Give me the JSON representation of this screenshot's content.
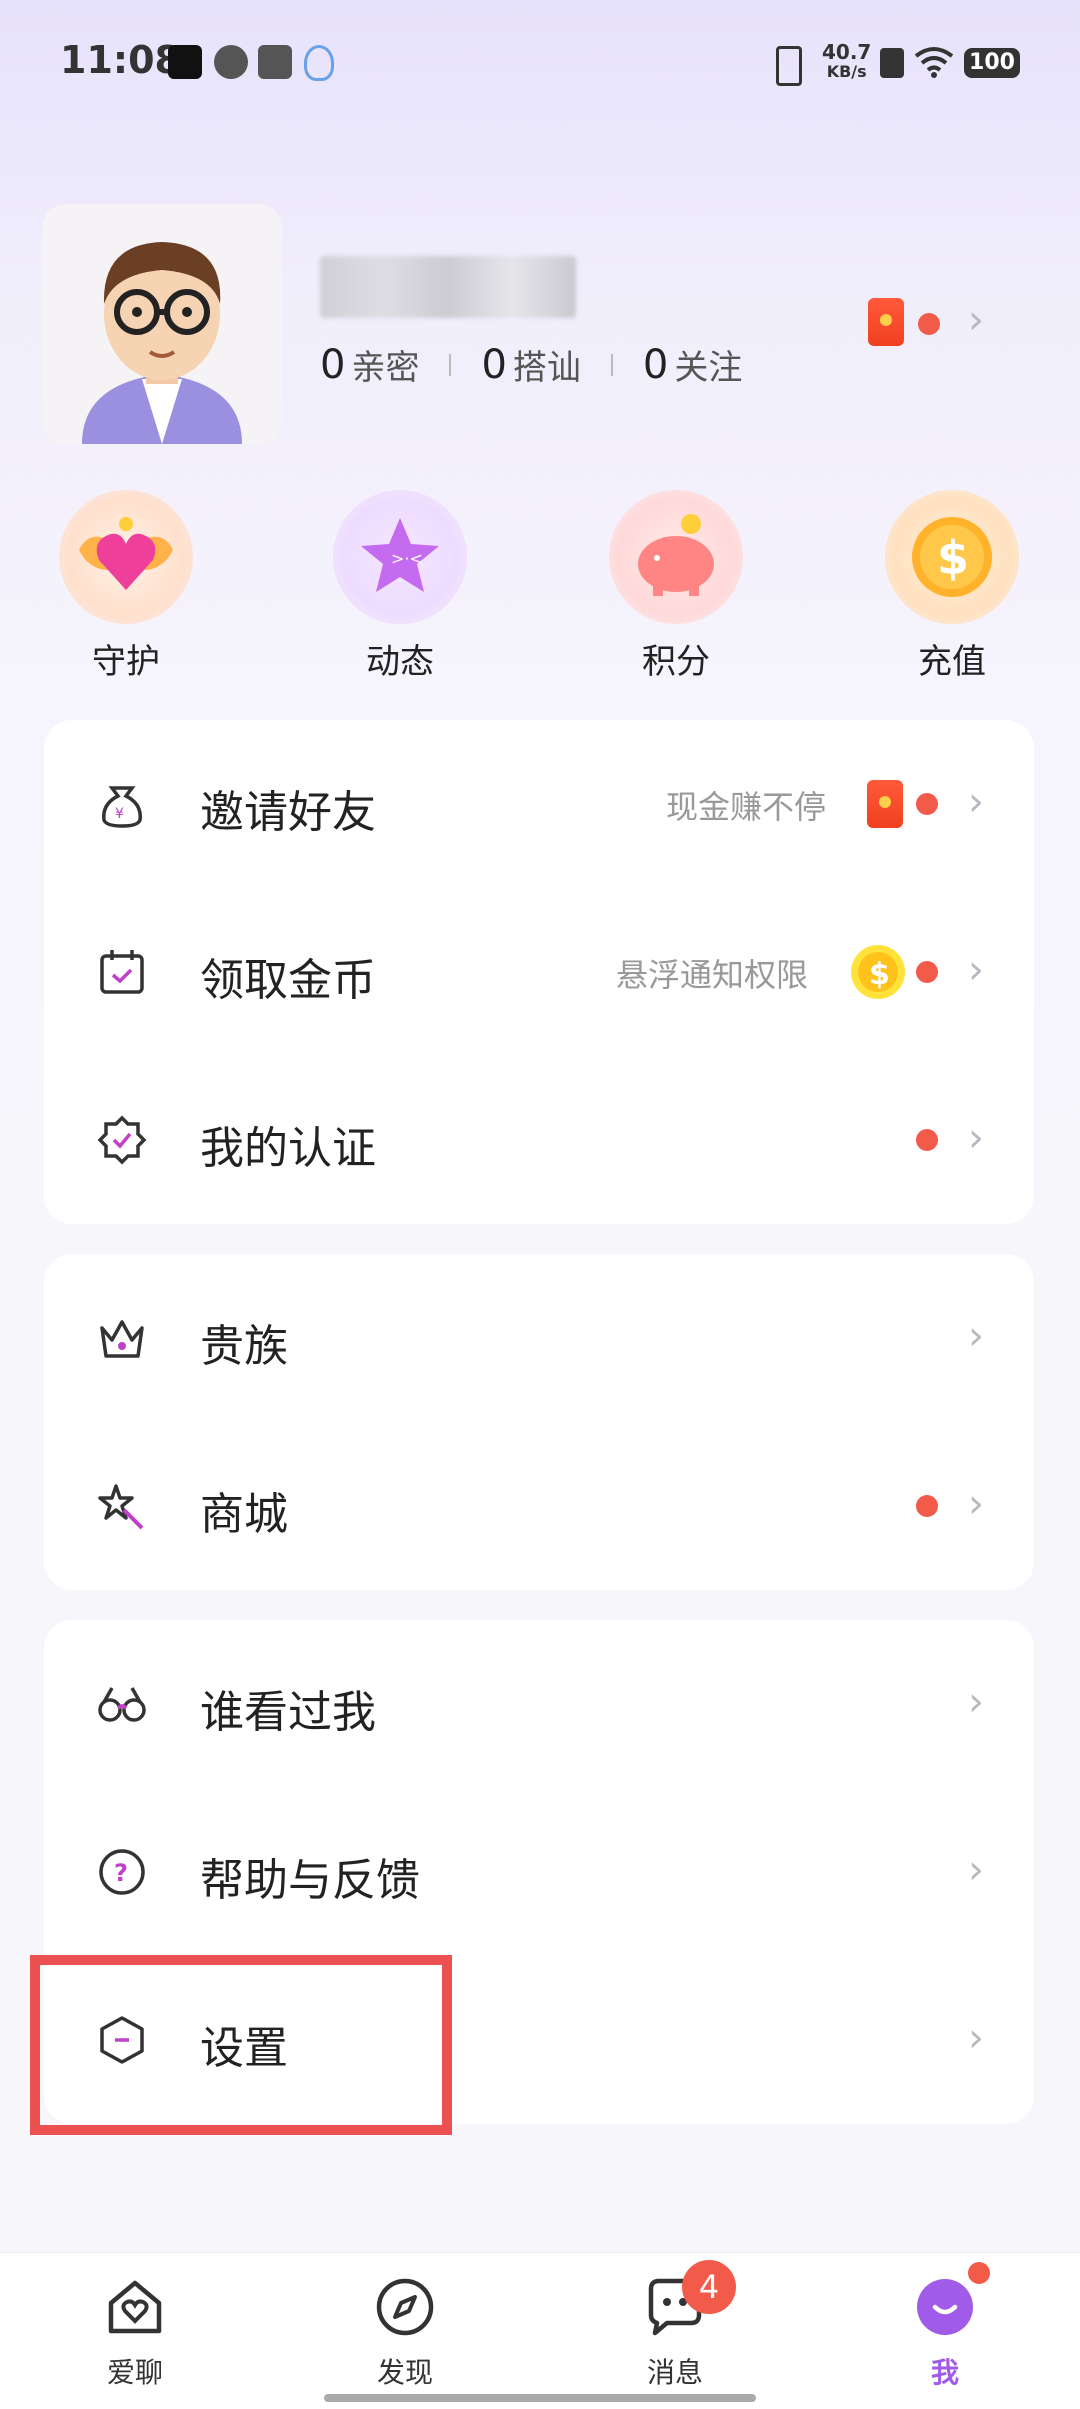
{
  "status_bar": {
    "time": "11:08",
    "net_speed_value": "40.7",
    "net_speed_unit": "KB/s",
    "battery": "100"
  },
  "profile": {
    "stats": [
      {
        "num": "0",
        "label": "亲密"
      },
      {
        "num": "0",
        "label": "搭讪"
      },
      {
        "num": "0",
        "label": "关注"
      }
    ]
  },
  "quick_actions": [
    {
      "label": "守护",
      "icon": "guard-heart-icon"
    },
    {
      "label": "动态",
      "icon": "star-icon"
    },
    {
      "label": "积分",
      "icon": "piggy-bank-icon"
    },
    {
      "label": "充值",
      "icon": "coin-icon"
    }
  ],
  "menu": {
    "invite": {
      "label": "邀请好友",
      "hint": "现金赚不停"
    },
    "coins": {
      "label": "领取金币",
      "hint": "悬浮通知权限"
    },
    "verify": {
      "label": "我的认证"
    },
    "noble": {
      "label": "贵族"
    },
    "mall": {
      "label": "商城"
    },
    "visitors": {
      "label": "谁看过我"
    },
    "help": {
      "label": "帮助与反馈"
    },
    "settings": {
      "label": "设置"
    }
  },
  "nav": {
    "tabs": [
      {
        "label": "爱聊"
      },
      {
        "label": "发现"
      },
      {
        "label": "消息"
      },
      {
        "label": "我"
      }
    ],
    "message_badge": "4"
  },
  "colors": {
    "accent": "#a05ce8",
    "badge": "#f25a4a",
    "highlight": "#ec5151"
  }
}
